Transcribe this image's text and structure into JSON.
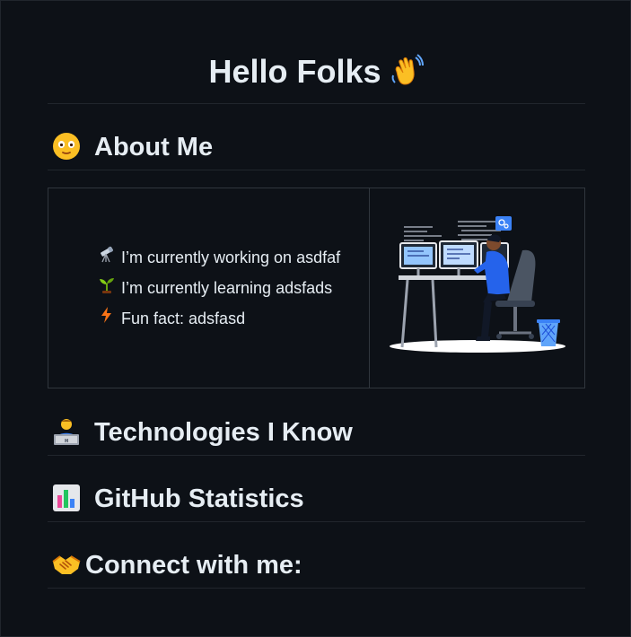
{
  "header": {
    "title": "Hello Folks",
    "wave_icon": "waving-hand-icon"
  },
  "about": {
    "title": "About Me",
    "icon": "smiling-face-icon",
    "facts": [
      {
        "icon": "telescope-icon",
        "text": "I’m currently working on asdfaf"
      },
      {
        "icon": "seedling-icon",
        "text": "I’m currently learning adsfads"
      },
      {
        "icon": "lightning-icon",
        "text": "Fun fact: adsfasd"
      }
    ],
    "illustration": "developer-at-desk-illustration"
  },
  "sections": [
    {
      "title": "Technologies I Know",
      "icon": "technologist-icon"
    },
    {
      "title": "GitHub Statistics",
      "icon": "bar-chart-icon"
    },
    {
      "title": "Connect with me:",
      "icon": "handshake-icon"
    }
  ],
  "colors": {
    "background": "#0d1117",
    "text": "#e6edf3",
    "divider": "#21262d",
    "table_border": "#30363d",
    "accent_blue": "#3b82f6"
  }
}
